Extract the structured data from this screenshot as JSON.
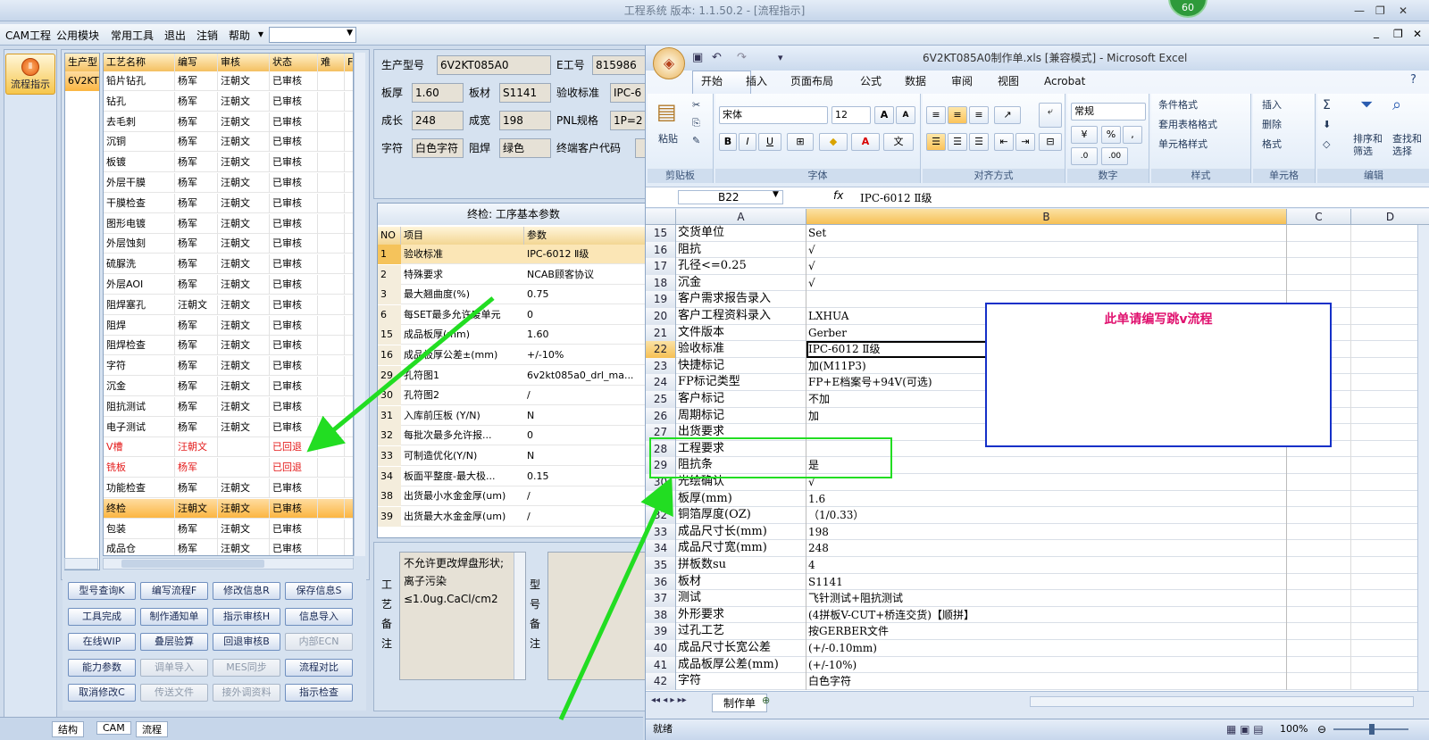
{
  "app": {
    "title": "工程系统  版本: 1.1.50.2 - [流程指示]",
    "badge": "60",
    "win_min": "—",
    "win_max": "❐",
    "win_close": "✕"
  },
  "menu": {
    "items": [
      "CAM工程",
      "公用模块",
      "常用工具",
      "退出",
      "注销",
      "帮助"
    ],
    "overflow": "▾",
    "mdi": [
      "_",
      "❐",
      "✕"
    ]
  },
  "left": {
    "flow_label": "流程指示",
    "flow_glyph": "Ⅱ",
    "side_header": "生产型",
    "side_value": "6V2KT",
    "headers": [
      "工艺名称",
      "编写",
      "审核",
      "状态",
      "难",
      "F"
    ],
    "rows": [
      [
        "铅片钻孔",
        "杨军",
        "汪朝文",
        "已审核"
      ],
      [
        "钻孔",
        "杨军",
        "汪朝文",
        "已审核"
      ],
      [
        "去毛刺",
        "杨军",
        "汪朝文",
        "已审核"
      ],
      [
        "沉铜",
        "杨军",
        "汪朝文",
        "已审核"
      ],
      [
        "板镀",
        "杨军",
        "汪朝文",
        "已审核"
      ],
      [
        "外层干膜",
        "杨军",
        "汪朝文",
        "已审核"
      ],
      [
        "干膜检查",
        "杨军",
        "汪朝文",
        "已审核"
      ],
      [
        "图形电镀",
        "杨军",
        "汪朝文",
        "已审核"
      ],
      [
        "外层蚀刻",
        "杨军",
        "汪朝文",
        "已审核"
      ],
      [
        "硫脲洗",
        "杨军",
        "汪朝文",
        "已审核"
      ],
      [
        "外层AOI",
        "杨军",
        "汪朝文",
        "已审核"
      ],
      [
        "阻焊塞孔",
        "汪朝文",
        "汪朝文",
        "已审核"
      ],
      [
        "阻焊",
        "杨军",
        "汪朝文",
        "已审核"
      ],
      [
        "阻焊检查",
        "杨军",
        "汪朝文",
        "已审核"
      ],
      [
        "字符",
        "杨军",
        "汪朝文",
        "已审核"
      ],
      [
        "沉金",
        "杨军",
        "汪朝文",
        "已审核"
      ],
      [
        "阻抗测试",
        "杨军",
        "汪朝文",
        "已审核"
      ],
      [
        "电子测试",
        "杨军",
        "汪朝文",
        "已审核"
      ],
      [
        "V槽",
        "汪朝文",
        "",
        "已回退"
      ],
      [
        "铣板",
        "杨军",
        "",
        "已回退"
      ],
      [
        "功能检查",
        "杨军",
        "汪朝文",
        "已审核"
      ],
      [
        "终检",
        "汪朝文",
        "汪朝文",
        "已审核"
      ],
      [
        "包装",
        "杨军",
        "汪朝文",
        "已审核"
      ],
      [
        "成品仓",
        "杨军",
        "汪朝文",
        "已审核"
      ]
    ],
    "buttons": [
      [
        "型号查询K",
        "编写流程F",
        "修改信息R",
        "保存信息S"
      ],
      [
        "工具完成",
        "制作通知单",
        "指示审核H",
        "信息导入"
      ],
      [
        "在线WIP",
        "叠层验算",
        "回退审核B",
        "内部ECN"
      ],
      [
        "能力参数",
        "调单导入",
        "MES同步",
        "流程对比"
      ],
      [
        "取消修改C",
        "传送文件",
        "接外调资料",
        "指示检查"
      ]
    ]
  },
  "info": {
    "labels": [
      "生产型号",
      "E工号",
      "板厚",
      "板材",
      "验收标准",
      "成长",
      "成宽",
      "PNL规格",
      "字符",
      "阻焊",
      "终端客户代码"
    ],
    "values": [
      "6V2KT085A0",
      "815986",
      "1.60",
      "S1141",
      "IPC-6",
      "248",
      "198",
      "1P=2",
      "白色字符",
      "绿色",
      ""
    ]
  },
  "params": {
    "title": "终检: 工序基本参数",
    "headers": [
      "NO",
      "项目",
      "参数"
    ],
    "rows": [
      [
        "1",
        "验收标准",
        "IPC-6012 Ⅱ级"
      ],
      [
        "2",
        "特殊要求",
        "NCAB顾客协议"
      ],
      [
        "3",
        "最大翘曲度(%)",
        "0.75"
      ],
      [
        "6",
        "每SET最多允许废单元",
        "0"
      ],
      [
        "15",
        "成品板厚(mm)",
        "1.60"
      ],
      [
        "16",
        "成品板厚公差±(mm)",
        "+/-10%"
      ],
      [
        "29",
        "孔符图1",
        "6v2kt085a0_drl_ma..."
      ],
      [
        "30",
        "孔符图2",
        "/"
      ],
      [
        "31",
        "入库前压板 (Y/N)",
        "N"
      ],
      [
        "32",
        "每批次最多允许报...",
        "0"
      ],
      [
        "33",
        "可制造优化(Y/N)",
        "N"
      ],
      [
        "34",
        "板面平整度-最大极...",
        "0.15"
      ],
      [
        "38",
        "出货最小水金金厚(um)",
        "/"
      ],
      [
        "39",
        "出货最大水金金厚(um)",
        "/"
      ]
    ],
    "remark_label": "工艺备注",
    "remark_text": "不允许更改焊盘形状;离子污染≤1.0ug.CaCl/cm2",
    "model_label": "型号备注"
  },
  "bottom_tabs": [
    "结构",
    "CAM",
    "流程"
  ],
  "excel": {
    "title": "6V2KT085A0制作单.xls  [兼容模式] - Microsoft Excel",
    "tabs": [
      "开始",
      "插入",
      "页面布局",
      "公式",
      "数据",
      "审阅",
      "视图",
      "Acrobat"
    ],
    "groups": [
      "剪贴板",
      "字体",
      "对齐方式",
      "数字",
      "样式",
      "单元格",
      "编辑"
    ],
    "font_name": "宋体",
    "font_size": "12",
    "number_format": "常规",
    "paste": "粘贴",
    "styles": [
      "条件格式",
      "套用表格格式",
      "单元格样式"
    ],
    "cells_cmds": [
      "插入",
      "删除",
      "格式"
    ],
    "edit_cmds": [
      "排序和筛选",
      "查找和选择"
    ],
    "name_box": "B22",
    "fx": "fx",
    "formula": "IPC-6012 Ⅱ级",
    "columns": [
      "A",
      "B",
      "C",
      "D"
    ],
    "rows": [
      [
        "15",
        "交货单位",
        "Set"
      ],
      [
        "16",
        "阻抗",
        "√"
      ],
      [
        "17",
        "孔径<=0.25",
        "√"
      ],
      [
        "18",
        "沉金",
        "√"
      ],
      [
        "19",
        "客户需求报告录入",
        ""
      ],
      [
        "20",
        "客户工程资料录入",
        "LXHUA"
      ],
      [
        "21",
        "文件版本",
        "Gerber"
      ],
      [
        "22",
        "验收标准",
        "IPC-6012 Ⅱ级"
      ],
      [
        "23",
        "快捷标记",
        "加(M11P3)"
      ],
      [
        "24",
        "FP标记类型",
        "FP+E档案号+94V(可选)"
      ],
      [
        "25",
        "客户标记",
        "不加"
      ],
      [
        "26",
        "周期标记",
        "加"
      ],
      [
        "27",
        "出货要求",
        ""
      ],
      [
        "28",
        "工程要求",
        ""
      ],
      [
        "29",
        "阻抗条",
        "是"
      ],
      [
        "30",
        "光绘确认",
        "√"
      ],
      [
        "31",
        "板厚(mm)",
        "1.6"
      ],
      [
        "32",
        "铜箔厚度(OZ)",
        "（1/0.33）"
      ],
      [
        "33",
        "成品尺寸长(mm)",
        "198"
      ],
      [
        "34",
        "成品尺寸宽(mm)",
        "248"
      ],
      [
        "35",
        "拼板数su",
        "4"
      ],
      [
        "36",
        "板材",
        "S1141"
      ],
      [
        "37",
        "测试",
        "飞针测试+阻抗测试"
      ],
      [
        "38",
        "外形要求",
        "(4拼板V-CUT+桥连交货)【顺拼】"
      ],
      [
        "39",
        "过孔工艺",
        "按GERBER文件"
      ],
      [
        "40",
        "成品尺寸长宽公差",
        "(+/-0.10mm)"
      ],
      [
        "41",
        "成品板厚公差(mm)",
        "(+/-10%)"
      ],
      [
        "42",
        "字符",
        "白色字符"
      ]
    ],
    "active_row": "22",
    "note": "此单请编写跳v流程",
    "sheet_tab": "制作单",
    "status": "就绪",
    "zoom": "100%"
  },
  "colors": {
    "arrow": "#22dd22",
    "note_border": "#1530c8",
    "note_text": "#e0106e",
    "selected": "#fbb642",
    "returned": "#e41b1b"
  }
}
